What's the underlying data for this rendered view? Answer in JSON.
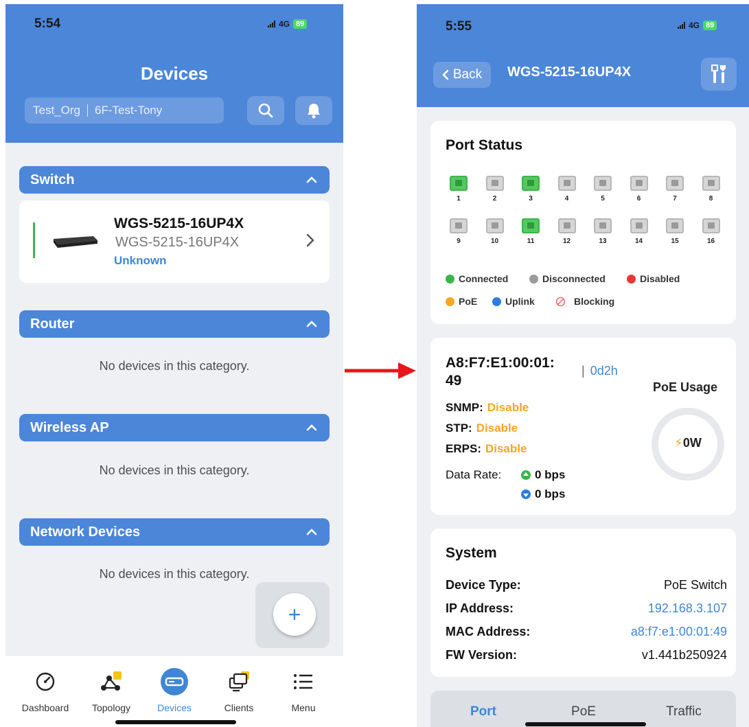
{
  "left_screen": {
    "status": {
      "time": "5:54",
      "network": "4G",
      "battery": "89"
    },
    "title": "Devices",
    "org": {
      "organization": "Test_Org",
      "site": "6F-Test-Tony"
    },
    "categories": [
      {
        "label": "Switch"
      },
      {
        "label": "Router",
        "empty_text": "No devices in this category."
      },
      {
        "label": "Wireless AP",
        "empty_text": "No devices in this category."
      },
      {
        "label": "Network Devices",
        "empty_text": "No devices in this category."
      }
    ],
    "switch_device": {
      "name": "WGS-5215-16UP4X",
      "model": "WGS-5215-16UP4X",
      "status": "Unknown"
    },
    "fab_label": "+",
    "tabs": [
      {
        "label": "Dashboard",
        "icon": "gauge-icon"
      },
      {
        "label": "Topology",
        "icon": "topology-icon"
      },
      {
        "label": "Devices",
        "icon": "devices-icon"
      },
      {
        "label": "Clients",
        "icon": "clients-icon"
      },
      {
        "label": "Menu",
        "icon": "menu-icon"
      }
    ],
    "active_tab": "Devices"
  },
  "right_screen": {
    "status": {
      "time": "5:55",
      "network": "4G",
      "battery": "89"
    },
    "back_label": "Back",
    "title": "WGS-5215-16UP4X",
    "port_status": {
      "title": "Port Status",
      "ports": [
        {
          "num": "1",
          "state": "connected"
        },
        {
          "num": "2",
          "state": "disconnected"
        },
        {
          "num": "3",
          "state": "connected"
        },
        {
          "num": "4",
          "state": "disconnected"
        },
        {
          "num": "5",
          "state": "disconnected"
        },
        {
          "num": "6",
          "state": "disconnected"
        },
        {
          "num": "7",
          "state": "disconnected"
        },
        {
          "num": "8",
          "state": "disconnected"
        },
        {
          "num": "9",
          "state": "disconnected"
        },
        {
          "num": "10",
          "state": "disconnected"
        },
        {
          "num": "11",
          "state": "connected"
        },
        {
          "num": "12",
          "state": "disconnected"
        },
        {
          "num": "13",
          "state": "disconnected"
        },
        {
          "num": "14",
          "state": "disconnected"
        },
        {
          "num": "15",
          "state": "disconnected"
        },
        {
          "num": "16",
          "state": "disconnected"
        }
      ],
      "legend": [
        {
          "label": "Connected",
          "color": "#3bb54a"
        },
        {
          "label": "Disconnected",
          "color": "#9b9b9b"
        },
        {
          "label": "Disabled",
          "color": "#e53935"
        },
        {
          "label": "PoE",
          "color": "#f5a623"
        },
        {
          "label": "Uplink",
          "color": "#2d7de0"
        },
        {
          "label": "Blocking",
          "color": "#e57373"
        }
      ]
    },
    "info": {
      "mac_line1": "A8:F7:E1:00:01:",
      "mac_line2": "49",
      "uptime": "0d2h",
      "snmp_label": "SNMP:",
      "snmp_value": "Disable",
      "stp_label": "STP:",
      "stp_value": "Disable",
      "erps_label": "ERPS:",
      "erps_value": "Disable",
      "data_rate_label": "Data Rate:",
      "rate_up": "0 bps",
      "rate_down": "0 bps",
      "poe_usage_label": "PoE Usage",
      "poe_usage_value": "0W"
    },
    "system": {
      "title": "System",
      "rows": [
        {
          "key": "Device Type:",
          "value": "PoE Switch"
        },
        {
          "key": "IP Address:",
          "value": "192.168.3.107"
        },
        {
          "key": "MAC Address:",
          "value": "a8:f7:e1:00:01:49"
        },
        {
          "key": "FW Version:",
          "value": "v1.441b250924"
        }
      ]
    },
    "tabs": [
      {
        "label": "Port"
      },
      {
        "label": "PoE"
      },
      {
        "label": "Traffic"
      }
    ],
    "active_tab": "Port"
  },
  "colors": {
    "brand_blue": "#4b86d9",
    "link_blue": "#3f86d6",
    "warning_orange": "#f5a623",
    "connected_green": "#3bb54a"
  }
}
